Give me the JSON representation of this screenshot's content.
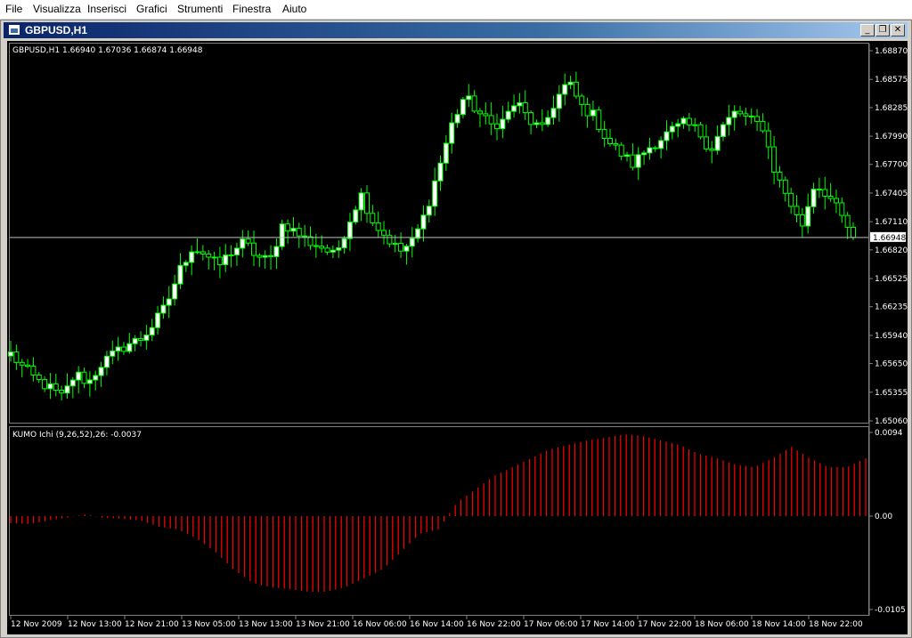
{
  "menu": {
    "file": "File",
    "view": "Visualizza",
    "insert": "Inserisci",
    "charts": "Grafici",
    "tools": "Strumenti",
    "window": "Finestra",
    "help": "Aiuto"
  },
  "window": {
    "title": "GBPUSD,H1",
    "minimize": "_",
    "restore": "❐",
    "close": "✕"
  },
  "chart_data": {
    "type": "candlestick",
    "title": "GBPUSD,H1  1.66940 1.67036 1.66874 1.66948",
    "background": "#000000",
    "colors": {
      "bull_body": "#ffffff",
      "bear_body": "#000000",
      "wick_outline": "#00ff00",
      "grid_line": "#808080",
      "indicator": "#ff0000",
      "text": "#ffffff"
    },
    "ylim": [
      1.6506,
      1.6887
    ],
    "y_ticks": [
      "1.68870",
      "1.68575",
      "1.68285",
      "1.67990",
      "1.67700",
      "1.67405",
      "1.67110",
      "1.66820",
      "1.66525",
      "1.66235",
      "1.65940",
      "1.65650",
      "1.65355",
      "1.65060"
    ],
    "current_price": "1.66948",
    "x_ticks": [
      "12 Nov 2009",
      "12 Nov 13:00",
      "12 Nov 21:00",
      "13 Nov 05:00",
      "13 Nov 13:00",
      "13 Nov 21:00",
      "16 Nov 06:00",
      "16 Nov 14:00",
      "16 Nov 22:00",
      "17 Nov 06:00",
      "17 Nov 14:00",
      "17 Nov 22:00",
      "18 Nov 06:00",
      "18 Nov 14:00",
      "18 Nov 22:00"
    ],
    "indicator": {
      "label": "KUMO Ichi (9,26,52),26:  -0.0037",
      "ylim": [
        -0.0105,
        0.0094
      ],
      "y_ticks": [
        "0.0094",
        "0.00",
        "-0.0105"
      ],
      "type": "histogram"
    },
    "close_path": [
      1.6575,
      1.656,
      1.6548,
      1.654,
      1.653,
      1.6555,
      1.6545,
      1.6565,
      1.6575,
      1.6585,
      1.659,
      1.6605,
      1.6625,
      1.666,
      1.6685,
      1.6678,
      1.6665,
      1.668,
      1.669,
      1.6675,
      1.667,
      1.671,
      1.67,
      1.669,
      1.6685,
      1.6675,
      1.6708,
      1.674,
      1.671,
      1.6695,
      1.668,
      1.669,
      1.672,
      1.6765,
      1.681,
      1.684,
      1.6825,
      1.681,
      1.6815,
      1.6835,
      1.6815,
      1.6805,
      1.6835,
      1.6855,
      1.683,
      1.682,
      1.6795,
      1.6782,
      1.677,
      1.6785,
      1.6795,
      1.6805,
      1.6812,
      1.6805,
      1.6785,
      1.681,
      1.6825,
      1.6815,
      1.681,
      1.676,
      1.6735,
      1.6705,
      1.675,
      1.674,
      1.6718,
      1.6695
    ],
    "histogram_path": [
      -0.0008,
      -0.0009,
      -0.0005,
      -0.0002,
      0.0002,
      -0.0002,
      -0.0003,
      -0.0005,
      -0.0012,
      -0.0015,
      -0.0025,
      -0.004,
      -0.006,
      -0.0075,
      -0.008,
      -0.0082,
      -0.0085,
      -0.0085,
      -0.008,
      -0.007,
      -0.006,
      -0.004,
      -0.002,
      -0.0015,
      0.0015,
      0.003,
      0.0045,
      0.0055,
      0.0065,
      0.0075,
      0.008,
      0.0085,
      0.0088,
      0.0092,
      0.009,
      0.0085,
      0.008,
      0.007,
      0.0065,
      0.0058,
      0.0055,
      0.0065,
      0.0078,
      0.0065,
      0.0055,
      0.0055,
      0.0065
    ]
  }
}
